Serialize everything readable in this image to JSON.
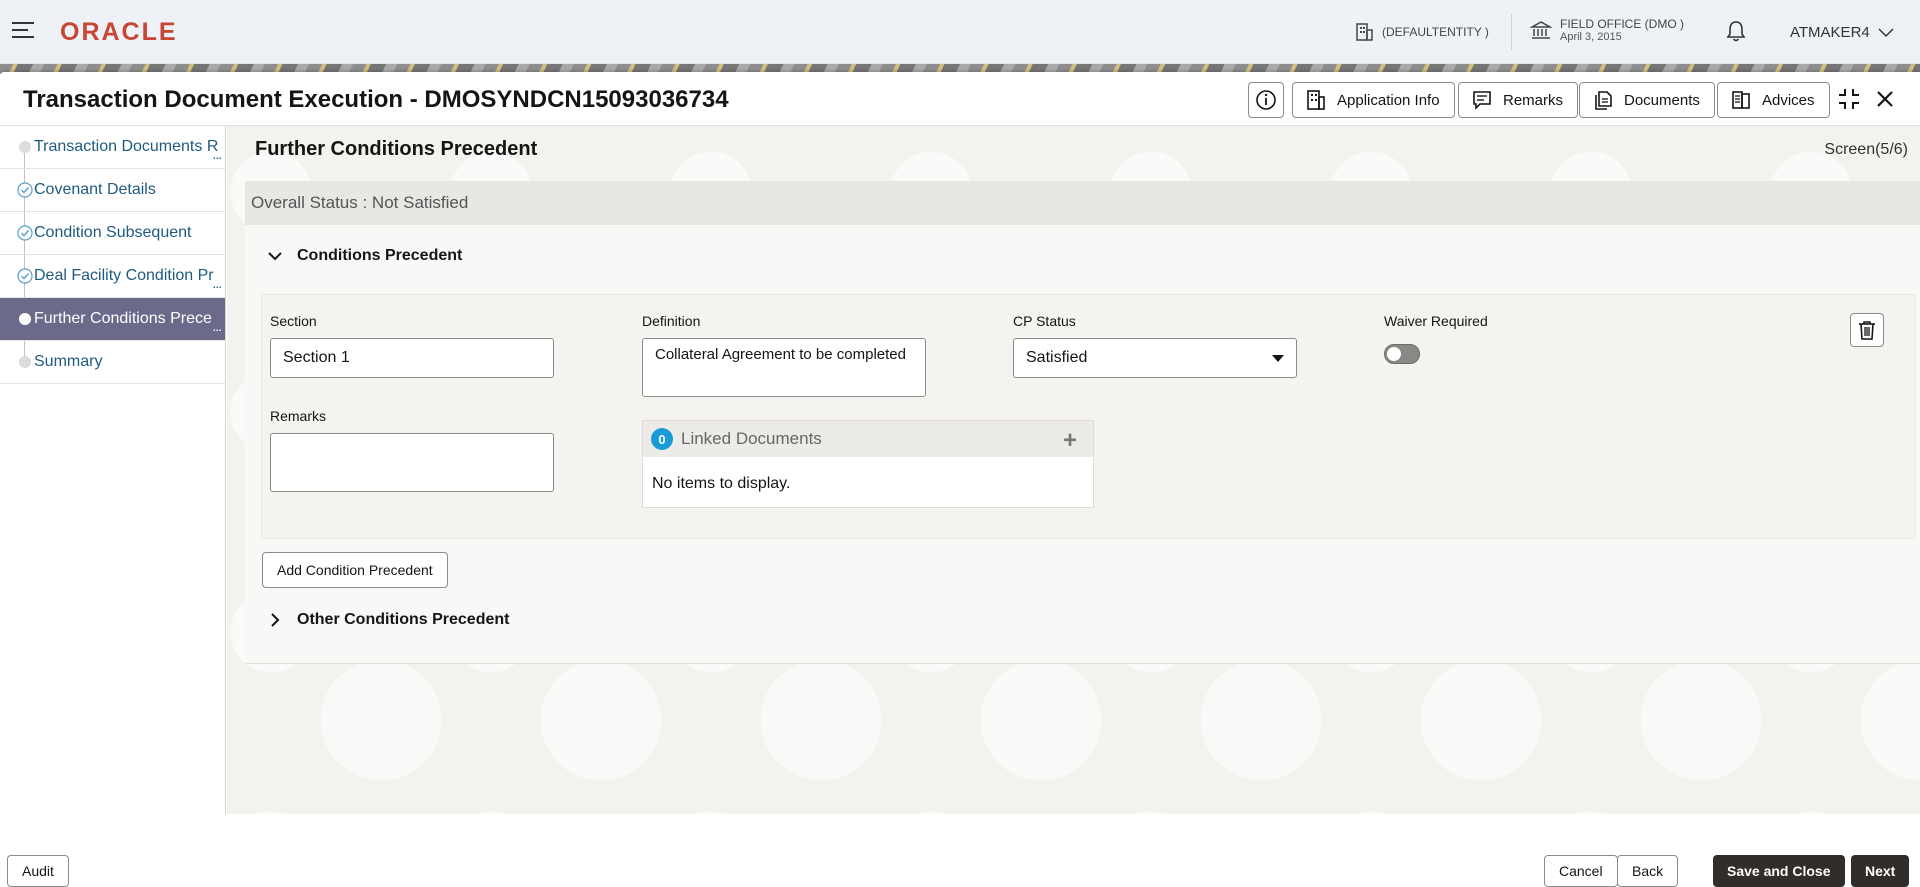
{
  "header": {
    "logo": "ORACLE",
    "entity": "(DEFAULTENTITY )",
    "office": "FIELD OFFICE (DMO )",
    "office_date": "April 3, 2015",
    "user": "ATMAKER4"
  },
  "window": {
    "title": "Transaction Document Execution - DMOSYNDCN15093036734",
    "toolbar": {
      "application_info": "Application Info",
      "remarks": "Remarks",
      "documents": "Documents",
      "advices": "Advices"
    }
  },
  "nav": {
    "items": [
      {
        "label": "Transaction Documents R",
        "state": "pending"
      },
      {
        "label": "Covenant Details",
        "state": "done"
      },
      {
        "label": "Condition Subsequent",
        "state": "done"
      },
      {
        "label": "Deal Facility Condition Pr",
        "state": "done"
      },
      {
        "label": "Further Conditions Prece",
        "state": "active"
      },
      {
        "label": "Summary",
        "state": "pending"
      }
    ],
    "more": "..."
  },
  "page": {
    "title": "Further Conditions Precedent",
    "screen": "Screen(5/6)",
    "overall_status": "Overall Status : Not Satisfied",
    "cp_section_title": "Conditions Precedent",
    "other_section_title": "Other Conditions Precedent",
    "add_button": "Add Condition Precedent"
  },
  "form": {
    "section_label": "Section",
    "section_value": "Section 1",
    "definition_label": "Definition",
    "definition_value": "Collateral Agreement to be completed",
    "cp_status_label": "CP Status",
    "cp_status_value": "Satisfied",
    "waiver_label": "Waiver Required",
    "waiver_on": false,
    "remarks_label": "Remarks",
    "remarks_value": ""
  },
  "linked_documents": {
    "count": "0",
    "title": "Linked Documents",
    "empty": "No items to display."
  },
  "footer": {
    "audit": "Audit",
    "cancel": "Cancel",
    "back": "Back",
    "save_close": "Save and Close",
    "next": "Next"
  },
  "colors": {
    "brand": "#c74634",
    "nav_active": "#6c6a8a",
    "nav_link": "#1f5a80",
    "badge": "#1a9bd7",
    "primary_button": "#312d2a"
  }
}
